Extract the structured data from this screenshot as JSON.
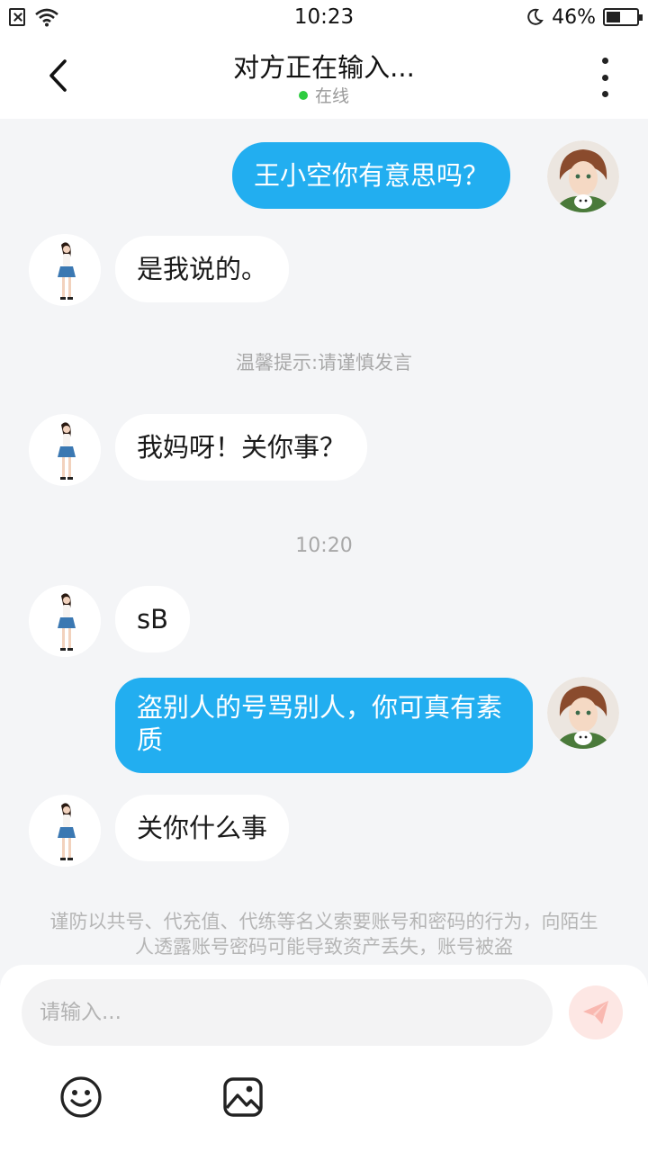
{
  "status_bar": {
    "time": "10:23",
    "battery": "46%",
    "battery_level": 0.46,
    "icons": [
      "sim-off-icon",
      "wifi-icon",
      "moon-icon",
      "battery-icon"
    ]
  },
  "header": {
    "title": "对方正在输入...",
    "status": "在线",
    "status_color": "#2ecc40",
    "icons": [
      "back-arrow-icon",
      "more-vertical-icon"
    ]
  },
  "messages": [
    {
      "side": "out",
      "text": "王小空你有意思吗？"
    },
    {
      "side": "in",
      "text": "是我说的。"
    },
    {
      "side": "system",
      "text": "温馨提示:请谨慎发言"
    },
    {
      "side": "in",
      "text": "我妈呀！关你事？"
    },
    {
      "side": "time",
      "text": "10:20"
    },
    {
      "side": "in",
      "text": "sB"
    },
    {
      "side": "out",
      "text": "盗别人的号骂别人，你可真有素质"
    },
    {
      "side": "in",
      "text": "关你什么事"
    }
  ],
  "warning": "谨防以共号、代充值、代练等名义索要账号和密码的行为，向陌生人透露账号密码可能导致资产丢失，账号被盗",
  "input": {
    "placeholder": "请输入...",
    "value": ""
  },
  "toolbar": [
    "emoji-icon",
    "image-icon",
    "send-icon"
  ],
  "colors": {
    "outgoing_bubble": "#22aef0",
    "incoming_bubble": "#ffffff",
    "background": "#f4f5f7",
    "send_button": "#fde7e4"
  }
}
